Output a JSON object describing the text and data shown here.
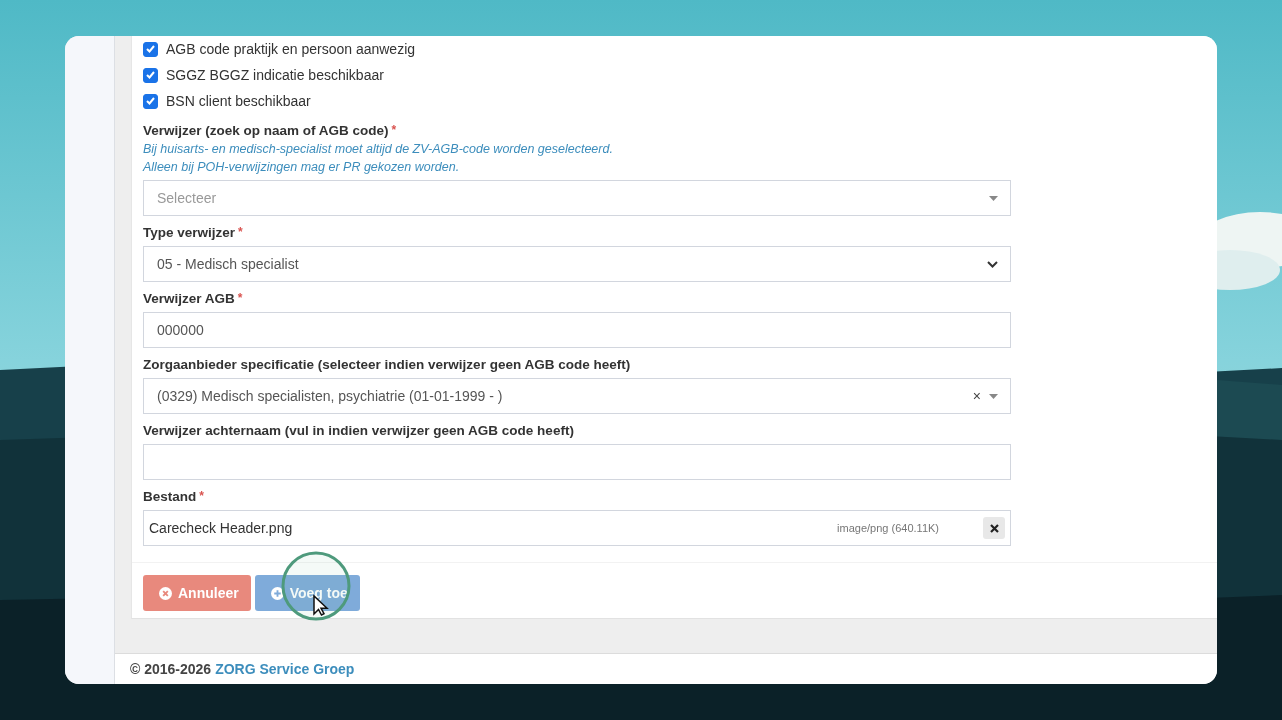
{
  "checkboxes": [
    {
      "label": "AGB code praktijk en persoon aanwezig",
      "checked": true
    },
    {
      "label": "SGGZ BGGZ indicatie beschikbaar",
      "checked": true
    },
    {
      "label": "BSN client beschikbaar",
      "checked": true
    }
  ],
  "fields": [
    {
      "kind": "search-select",
      "label": "Verwijzer (zoek op naam of AGB code)",
      "required_mark": "*",
      "hints": [
        "Bij huisarts- en medisch-specialist moet altijd de ZV-AGB-code worden geselecteerd.",
        "Alleen bij POH-verwijzingen mag er PR gekozen worden."
      ],
      "placeholder": "Selecteer"
    },
    {
      "kind": "select",
      "label": "Type verwijzer",
      "required_mark": "*",
      "value": "05 - Medisch specialist"
    },
    {
      "kind": "text",
      "label": "Verwijzer AGB",
      "required_mark": "*",
      "value": "000000"
    },
    {
      "kind": "clearable-select",
      "label": "Zorgaanbieder specificatie (selecteer indien verwijzer geen AGB code heeft)",
      "value": "(0329) Medisch specialisten, psychiatrie (01-01-1999 - )",
      "clear": "×"
    },
    {
      "kind": "text",
      "label": "Verwijzer achternaam (vul in indien verwijzer geen AGB code heeft)"
    },
    {
      "kind": "file",
      "label": "Bestand",
      "required_mark": "*",
      "value": "Carecheck Header.png",
      "meta": "image/png (640.11K)"
    }
  ],
  "buttons": [
    {
      "label": "Annuleer",
      "kind": "cancel",
      "disabled": true
    },
    {
      "label": "Voeg toe",
      "kind": "add",
      "disabled": true
    }
  ],
  "footer": {
    "text": "© 2016-2026",
    "link": "ZORG Service Groep"
  }
}
